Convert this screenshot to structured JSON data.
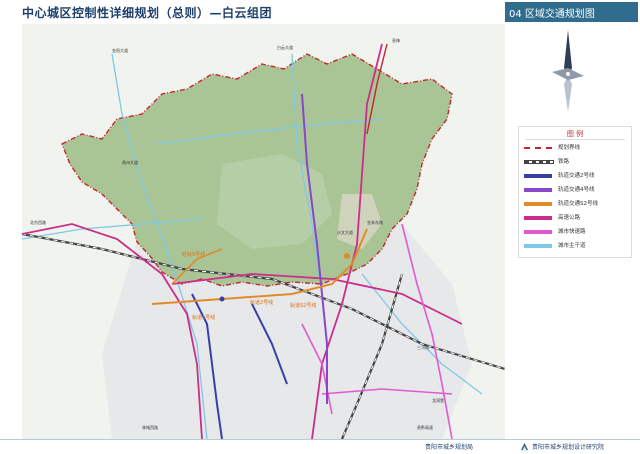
{
  "header": {
    "title": "中心城区控制性详细规划（总则）—白云组团",
    "section": "04 区域交通规划图"
  },
  "legend": {
    "title": "图  例",
    "items": [
      {
        "label": "规划界线",
        "color": "#c1272d",
        "style": "dash-dot"
      },
      {
        "label": "铁路",
        "color": "#444444",
        "style": "rail"
      },
      {
        "label": "轨道交通2号线",
        "color": "#3a3fa8",
        "style": "solid"
      },
      {
        "label": "轨道交通4号线",
        "color": "#8a46c9",
        "style": "solid"
      },
      {
        "label": "轨道交通S2号线",
        "color": "#e08b2a",
        "style": "solid"
      },
      {
        "label": "高速公路",
        "color": "#cc2d8a",
        "style": "solid"
      },
      {
        "label": "城市快速路",
        "color": "#e05ad2",
        "style": "solid"
      },
      {
        "label": "城市主干道",
        "color": "#7fc8e8",
        "style": "solid"
      }
    ]
  },
  "map": {
    "labels_orange": [
      "轻轨5号线",
      "轨道2号线",
      "轨道S2号线",
      "轨道1号线"
    ],
    "labels_small": [
      "金阳大道",
      "白云大道",
      "贵州大道",
      "北京西路",
      "沙文大道",
      "金朱东路",
      "三马线",
      "林城西路",
      "贵黔高速",
      "息烽",
      "龙洞堡"
    ]
  },
  "footer": {
    "left": "贵阳市城乡规划局",
    "right": "贵阳市城乡规划设计研究院"
  },
  "colors": {
    "brand": "#1f3f6b",
    "section_band": "#2f6c8e",
    "green_area": "#a9c596",
    "boundary": "#c1272d"
  }
}
